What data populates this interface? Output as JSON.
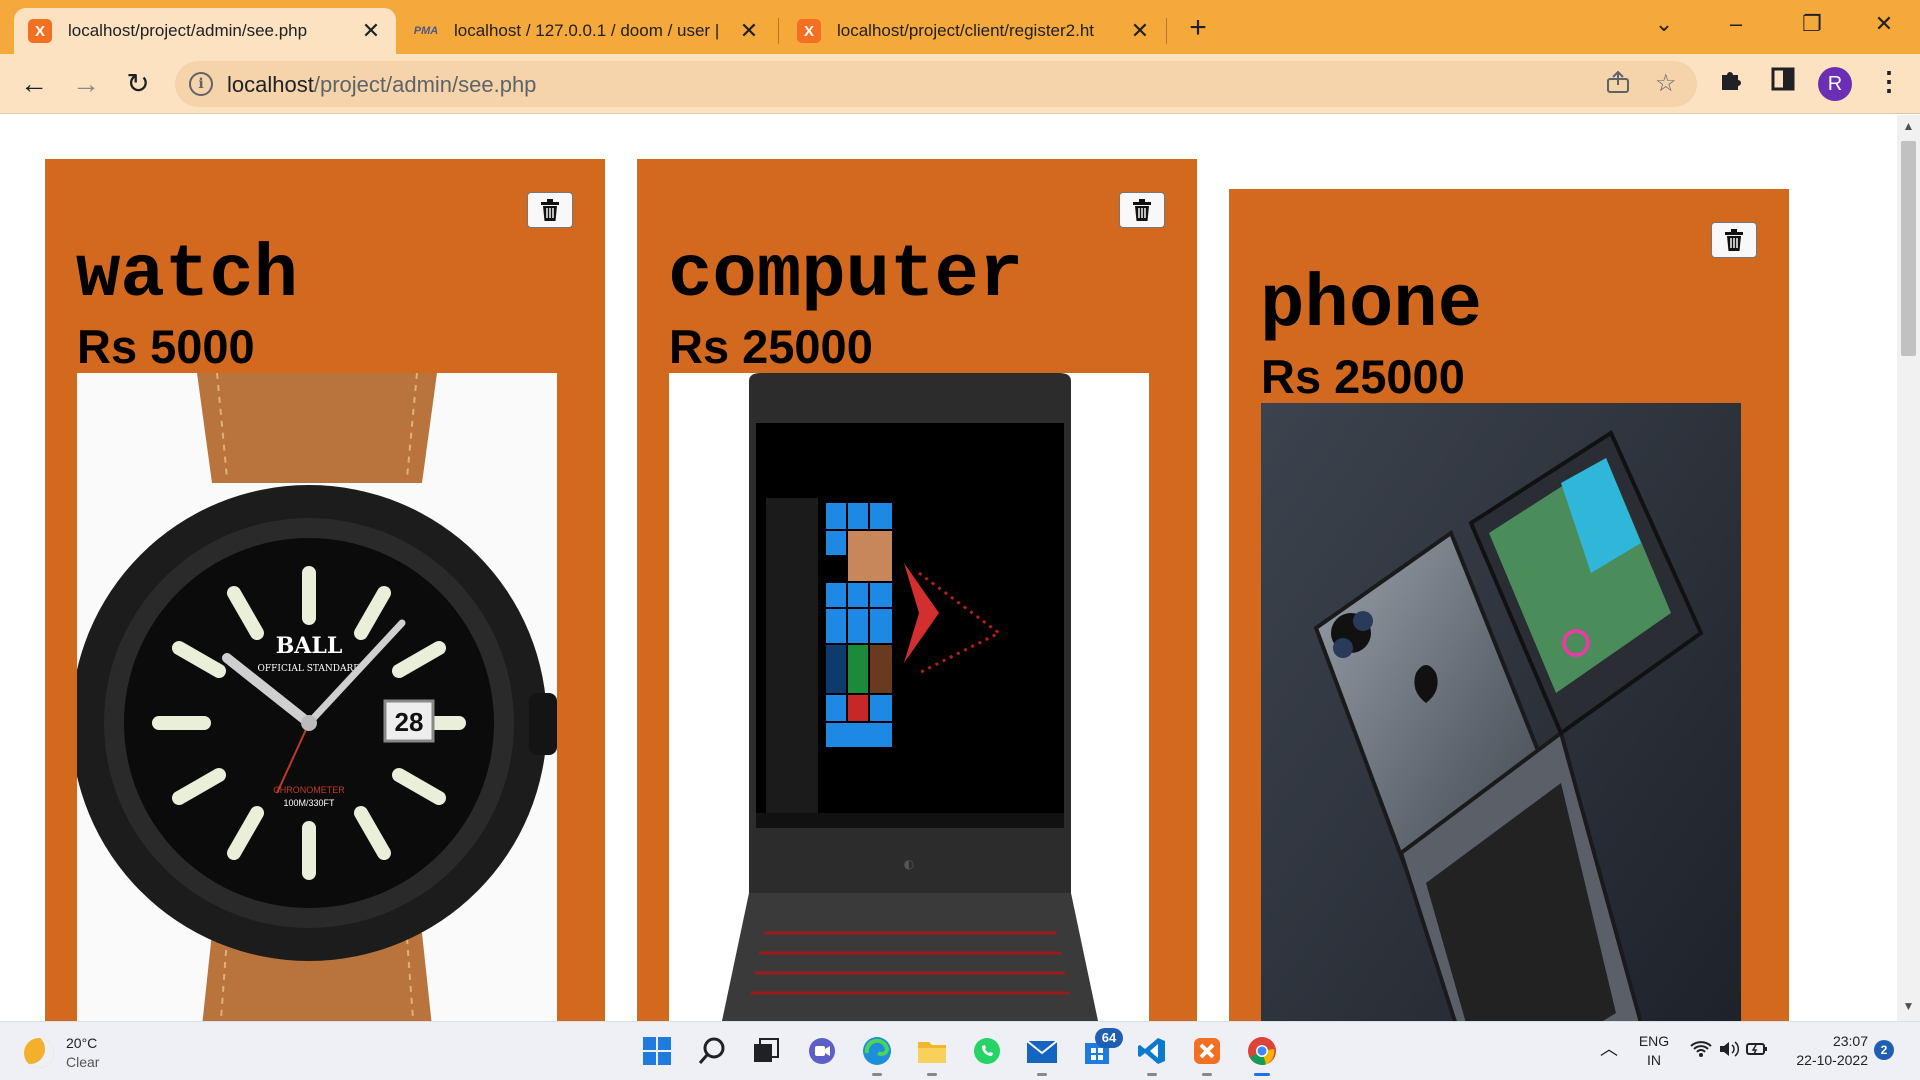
{
  "browser": {
    "tabs": [
      {
        "title": "localhost/project/admin/see.php",
        "active": true
      },
      {
        "title": "localhost / 127.0.0.1 / doom / user |",
        "active": false
      },
      {
        "title": "localhost/project/client/register2.ht",
        "active": false
      }
    ],
    "pma_favicon_text": "PMA",
    "xampp_favicon_text": "X",
    "address": {
      "host": "localhost",
      "path": "/project/admin/see.php"
    },
    "profile_initial": "R"
  },
  "products": [
    {
      "name": "watch",
      "price": "Rs 5000"
    },
    {
      "name": "computer",
      "price": "Rs 25000"
    },
    {
      "name": "phone",
      "price": "Rs 25000"
    }
  ],
  "photo_text": {
    "watch_brand": "BALL",
    "watch_brand_sub": "OFFICIAL STANDARD",
    "watch_date": "28",
    "watch_chronometer": "CHRONOMETER",
    "watch_depth": "100M/330FT"
  },
  "taskbar": {
    "weather_temp": "20°C",
    "weather_desc": "Clear",
    "store_badge": "64",
    "language": "ENG",
    "region": "IN",
    "time": "23:07",
    "date": "22-10-2022",
    "notifications": "2"
  },
  "colors": {
    "card": "#d2691e",
    "tabstrip": "#f6a93b",
    "toolbar": "#fde2c1"
  }
}
